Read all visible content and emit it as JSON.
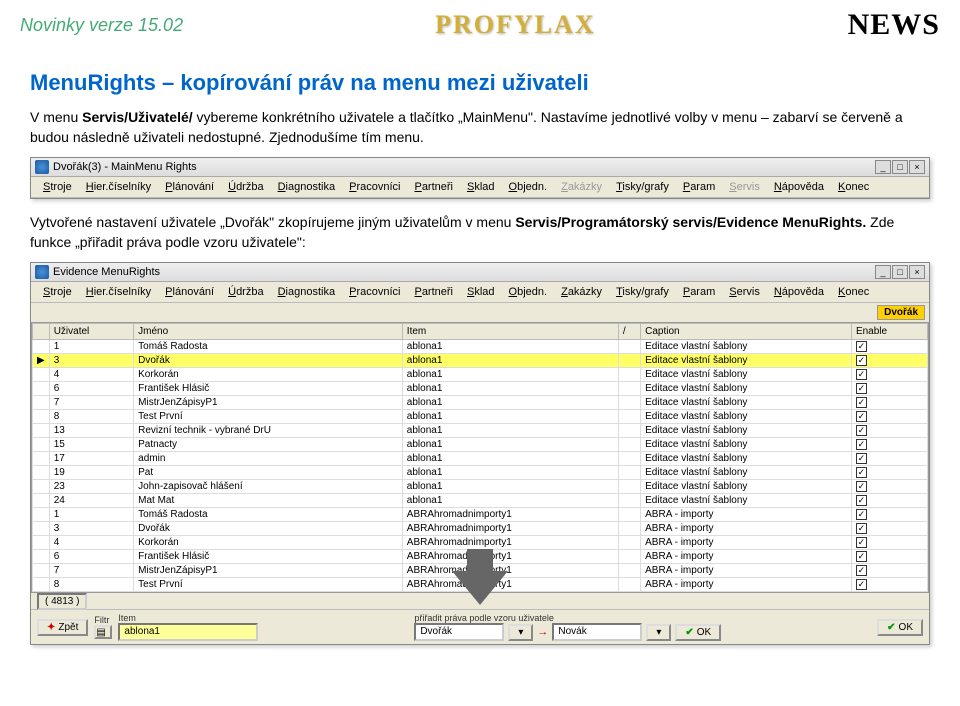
{
  "header": {
    "version": "Novinky verze 15.02",
    "logo": "PROFYLAX",
    "news": "NEWS"
  },
  "section": {
    "title": "MenuRights – kopírování práv na menu mezi uživateli",
    "para1_a": "   V menu ",
    "para1_b": "Servis/Uživatelé/",
    "para1_c": " vybereme konkrétního uživatele a tlačítko „MainMenu\". Nastavíme jednotlivé volby v menu – zabarví se červeně a budou následně uživateli nedostupné. Zjednodušíme tím menu.",
    "para2_a": "   Vytvořené nastavení uživatele „Dvořák\" zkopírujeme jiným uživatelům v menu ",
    "para2_b": "Servis/Programátorský servis/Evidence MenuRights.",
    "para2_c": " Zde funkce „přiřadit práva podle vzoru uživatele\":"
  },
  "win1": {
    "title": "Dvořák(3) - MainMenu Rights",
    "menu": [
      "Stroje",
      "Hier.číselníky",
      "Plánování",
      "Údržba",
      "Diagnostika",
      "Pracovníci",
      "Partneři",
      "Sklad",
      "Objedn.",
      "Zakázky",
      "Tisky/grafy",
      "Param",
      "Servis",
      "Nápověda",
      "Konec"
    ]
  },
  "win2": {
    "title": "Evidence MenuRights",
    "menu": [
      "Stroje",
      "Hier.číselníky",
      "Plánování",
      "Údržba",
      "Diagnostika",
      "Pracovníci",
      "Partneři",
      "Sklad",
      "Objedn.",
      "Zakázky",
      "Tisky/grafy",
      "Param",
      "Servis",
      "Nápověda",
      "Konec"
    ],
    "userchip": "Dvořák",
    "cols": [
      "Uživatel",
      "Jméno",
      "Item",
      "/",
      "Caption",
      "Enable"
    ],
    "rows": [
      {
        "id": "1",
        "name": "Tomáš Radosta",
        "item": "ablona1",
        "caption": "Editace vlastní šablony",
        "chk": true
      },
      {
        "id": "3",
        "name": "Dvořák",
        "item": "ablona1",
        "caption": "Editace vlastní šablony",
        "chk": true,
        "sel": true
      },
      {
        "id": "4",
        "name": "Korkorán",
        "item": "ablona1",
        "caption": "Editace vlastní šablony",
        "chk": true
      },
      {
        "id": "6",
        "name": "František Hlásič",
        "item": "ablona1",
        "caption": "Editace vlastní šablony",
        "chk": true
      },
      {
        "id": "7",
        "name": "MistrJenZápisyP1",
        "item": "ablona1",
        "caption": "Editace vlastní šablony",
        "chk": true
      },
      {
        "id": "8",
        "name": "Test První",
        "item": "ablona1",
        "caption": "Editace vlastní šablony",
        "chk": true
      },
      {
        "id": "13",
        "name": "Revizní technik - vybrané DrU",
        "item": "ablona1",
        "caption": "Editace vlastní šablony",
        "chk": true
      },
      {
        "id": "15",
        "name": "Patnacty",
        "item": "ablona1",
        "caption": "Editace vlastní šablony",
        "chk": true
      },
      {
        "id": "17",
        "name": "admin",
        "item": "ablona1",
        "caption": "Editace vlastní šablony",
        "chk": true
      },
      {
        "id": "19",
        "name": "Pat",
        "item": "ablona1",
        "caption": "Editace vlastní šablony",
        "chk": true
      },
      {
        "id": "23",
        "name": "John-zapisovač hlášení",
        "item": "ablona1",
        "caption": "Editace vlastní šablony",
        "chk": true
      },
      {
        "id": "24",
        "name": "Mat Mat",
        "item": "ablona1",
        "caption": "Editace vlastní šablony",
        "chk": true
      },
      {
        "id": "1",
        "name": "Tomáš Radosta",
        "item": "ABRAhromadnimporty1",
        "caption": "ABRA - importy",
        "chk": true
      },
      {
        "id": "3",
        "name": "Dvořák",
        "item": "ABRAhromadnimporty1",
        "caption": "ABRA - importy",
        "chk": true
      },
      {
        "id": "4",
        "name": "Korkorán",
        "item": "ABRAhromadnimporty1",
        "caption": "ABRA - importy",
        "chk": true
      },
      {
        "id": "6",
        "name": "František Hlásič",
        "item": "ABRAhromadnimporty1",
        "caption": "ABRA - importy",
        "chk": true
      },
      {
        "id": "7",
        "name": "MistrJenZápisyP1",
        "item": "ABRAhromadnimporty1",
        "caption": "ABRA - importy",
        "chk": true
      },
      {
        "id": "8",
        "name": "Test První",
        "item": "ABRAhromadnimporty1",
        "caption": "ABRA - importy",
        "chk": true
      }
    ],
    "count": "( 4813 )",
    "footer": {
      "back": "Zpět",
      "filtr": "Filtr",
      "item_lbl": "Item",
      "item_val": "ablona1",
      "assign": "přiřadit práva podle vzoru uživatele",
      "src": "Dvořák",
      "dst": "Novák",
      "ok": "OK",
      "ok2": "OK"
    }
  }
}
